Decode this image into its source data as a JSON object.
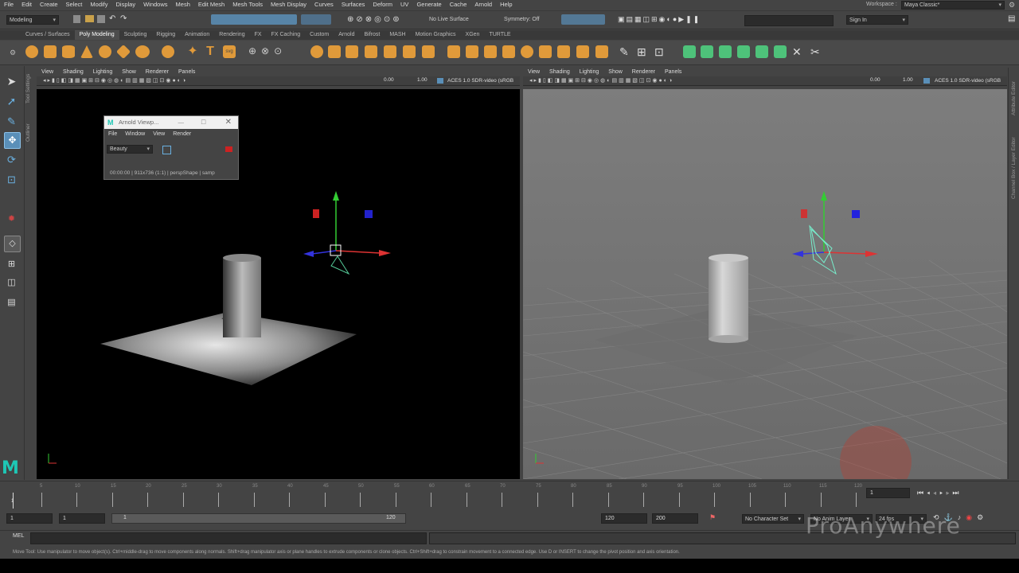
{
  "menubar": {
    "items": [
      "File",
      "Edit",
      "Create",
      "Select",
      "Modify",
      "Display",
      "Windows",
      "Mesh",
      "Edit Mesh",
      "Mesh Tools",
      "Mesh Display",
      "Curves",
      "Surfaces",
      "Deform",
      "UV",
      "Generate",
      "Cache",
      "Arnold",
      "Help"
    ],
    "workspace_label": "Workspace :",
    "workspace_value": "Maya Classic*"
  },
  "statusline": {
    "mode": "Modeling",
    "live_surface": "No Live Surface",
    "symmetry": "Symmetry: Off",
    "sign_in": "Sign In"
  },
  "shelf": {
    "tabs": [
      "Curves / Surfaces",
      "Poly Modeling",
      "Sculpting",
      "Rigging",
      "Animation",
      "Rendering",
      "FX",
      "FX Caching",
      "Custom",
      "Arnold",
      "Bifrost",
      "MASH",
      "Motion Graphics",
      "XGen",
      "TURTLE"
    ],
    "active_tab": "Poly Modeling"
  },
  "toolbox": {
    "side_labels": [
      "Tool Settings",
      "Outliner"
    ]
  },
  "left_panel": {
    "menu": [
      "View",
      "Shading",
      "Lighting",
      "Show",
      "Renderer",
      "Panels"
    ],
    "exposure": "0.00",
    "gamma": "1.00",
    "color_space": "ACES 1.0 SDR-video (sRGB"
  },
  "right_panel": {
    "menu": [
      "View",
      "Shading",
      "Lighting",
      "Show",
      "Renderer",
      "Panels"
    ],
    "exposure": "0.00",
    "gamma": "1.00",
    "color_space": "ACES 1.0 SDR-video (sRGB"
  },
  "right_side_tabs": [
    "Attribute Editor",
    "Channel Box / Layer Editor"
  ],
  "arnold_window": {
    "title": "Arnold Viewp...",
    "menu": [
      "File",
      "Window",
      "View",
      "Render"
    ],
    "aov": "Beauty",
    "status": "00:00:00 | 911x736 (1:1) | perspShape  | samp"
  },
  "timeline": {
    "labels": [
      "5",
      "10",
      "15",
      "20",
      "25",
      "30",
      "35",
      "40",
      "45",
      "50",
      "55",
      "60",
      "65",
      "70",
      "75",
      "80",
      "85",
      "90",
      "95",
      "100",
      "105",
      "110",
      "115",
      "120"
    ],
    "current_frame_marker": "1",
    "current_frame": "1"
  },
  "range": {
    "start": "1",
    "anim_start": "1",
    "slider_start": "1",
    "slider_end": "120",
    "anim_end": "120",
    "end": "200",
    "character_set": "No Character Set",
    "anim_layer": "No Anim Layer",
    "fps": "24 fps"
  },
  "mel": {
    "label": "MEL"
  },
  "helpline": {
    "text": "Move Tool: Use manipulator to move object(s). Ctrl+middle-drag to move components along normals. Shift+drag manipulator axis or plane handles to extrude components or clone objects. Ctrl+Shift+drag to constrain movement to a connected edge. Use D or INSERT to change the pivot position and axis orientation."
  },
  "watermark": {
    "text": "ProAnywhere"
  },
  "colors": {
    "accent": "#5a9fd4",
    "shelf_orange": "#e09a3a",
    "shelf_green": "#4ec27a",
    "bg": "#444444"
  }
}
